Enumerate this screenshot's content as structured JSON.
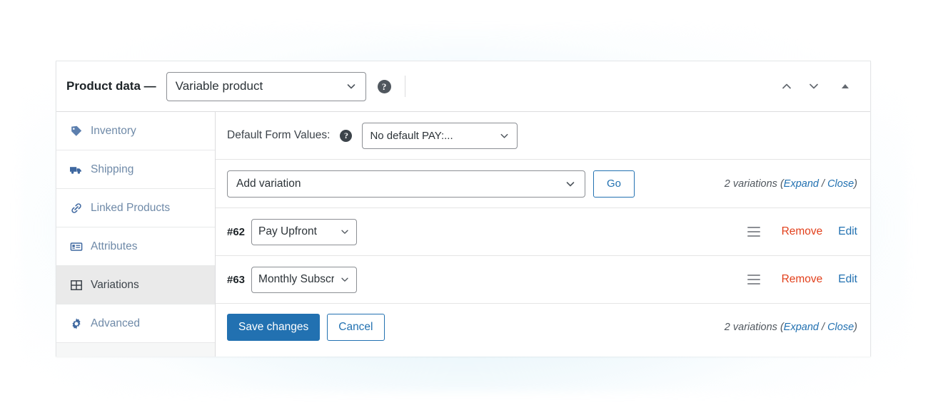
{
  "theme": {
    "accent": "#2271b1",
    "danger": "#e2401c",
    "sidebar_link": "#6f8aa8",
    "active_bg": "#eaeaea",
    "panel_border": "#dcdcde"
  },
  "header": {
    "title": "Product data —",
    "product_type": {
      "value": "Variable product",
      "chevron": "chevron-down-icon"
    },
    "help": "?",
    "controls": [
      {
        "name": "move-up-icon",
        "glyph": "chevron-up"
      },
      {
        "name": "move-down-icon",
        "glyph": "chevron-down"
      },
      {
        "name": "toggle-panel-icon",
        "glyph": "triangle-up"
      }
    ]
  },
  "sidebar": {
    "items": [
      {
        "label": "Inventory",
        "icon": "tag-icon",
        "active": false
      },
      {
        "label": "Shipping",
        "icon": "truck-icon",
        "active": false
      },
      {
        "label": "Linked Products",
        "icon": "link-icon",
        "active": false
      },
      {
        "label": "Attributes",
        "icon": "list-icon",
        "active": false
      },
      {
        "label": "Variations",
        "icon": "grid-icon",
        "active": true
      },
      {
        "label": "Advanced",
        "icon": "gear-icon",
        "active": false
      }
    ]
  },
  "main": {
    "defaults_row": {
      "label": "Default Form Values:",
      "help": "?",
      "select_value": "No default PAY:...",
      "options": [
        "No default PAY:..."
      ]
    },
    "toolbar": {
      "add_variation_value": "Add variation",
      "add_variation_options": [
        "Add variation"
      ],
      "go_label": "Go",
      "count_text": "2 variations (",
      "expand_label": "Expand",
      "separator": " / ",
      "close_label": "Close",
      "count_suffix": ")"
    },
    "variations": [
      {
        "id": "#62",
        "select_value": "Pay Upfront",
        "drag": "drag-handle-icon",
        "remove_label": "Remove",
        "edit_label": "Edit"
      },
      {
        "id": "#63",
        "select_value": "Monthly Subscri",
        "drag": "drag-handle-icon",
        "remove_label": "Remove",
        "edit_label": "Edit"
      }
    ],
    "footer": {
      "save_label": "Save changes",
      "cancel_label": "Cancel",
      "count_text": "2 variations (",
      "expand_label": "Expand",
      "separator": " / ",
      "close_label": "Close",
      "count_suffix": ")"
    }
  }
}
